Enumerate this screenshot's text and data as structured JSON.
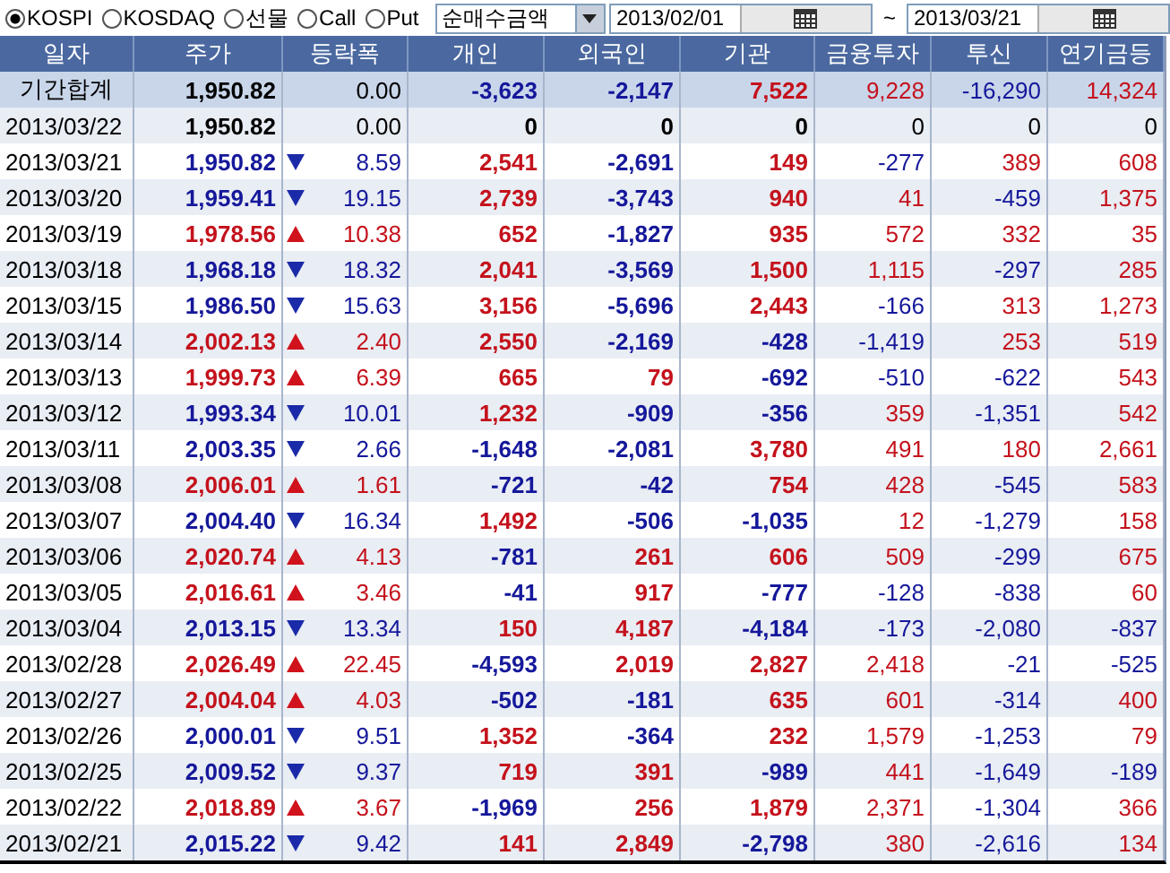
{
  "toolbar": {
    "markets": [
      {
        "label": "KOSPI",
        "selected": true
      },
      {
        "label": "KOSDAQ",
        "selected": false
      },
      {
        "label": "선물",
        "selected": false
      },
      {
        "label": "Call",
        "selected": false
      },
      {
        "label": "Put",
        "selected": false
      }
    ],
    "measure": {
      "value": "순매수금액"
    },
    "date_from": {
      "value": "2013/02/01"
    },
    "range_separator": "~",
    "date_to": {
      "value": "2013/03/21"
    }
  },
  "table": {
    "columns": [
      "일자",
      "주가",
      "등락폭",
      "개인",
      "외국인",
      "기관",
      "금융투자",
      "투신",
      "연기금등"
    ],
    "rows": [
      {
        "kind": "summary",
        "date": "기간합계",
        "price": "1,950.82",
        "color": "#000000",
        "change": "0.00",
        "flows": [
          {
            "value": "-3,623",
            "color": "#15189a"
          },
          {
            "value": "-2,147",
            "color": "#15189a"
          },
          {
            "value": "7,522",
            "color": "#c4121c"
          },
          {
            "value": "9,228",
            "color": "#c4121c"
          },
          {
            "value": "-16,290",
            "color": "#15189a"
          },
          {
            "value": "14,324",
            "color": "#c4121c"
          }
        ]
      },
      {
        "kind": "flat",
        "date": "2013/03/22",
        "price": "1,950.82",
        "color": "#000000",
        "change": "0.00",
        "flows": [
          {
            "value": "0",
            "color": "#000000"
          },
          {
            "value": "0",
            "color": "#000000"
          },
          {
            "value": "0",
            "color": "#000000"
          },
          {
            "value": "0",
            "color": "#000000"
          },
          {
            "value": "0",
            "color": "#000000"
          },
          {
            "value": "0",
            "color": "#000000"
          }
        ]
      },
      {
        "kind": "fall",
        "date": "2013/03/21",
        "price": "1,950.82",
        "color": "#15189a",
        "change": "8.59",
        "flows": [
          {
            "value": "2,541",
            "color": "#c4121c"
          },
          {
            "value": "-2,691",
            "color": "#15189a"
          },
          {
            "value": "149",
            "color": "#c4121c"
          },
          {
            "value": "-277",
            "color": "#15189a"
          },
          {
            "value": "389",
            "color": "#c4121c"
          },
          {
            "value": "608",
            "color": "#c4121c"
          }
        ]
      },
      {
        "kind": "fall",
        "date": "2013/03/20",
        "price": "1,959.41",
        "color": "#15189a",
        "change": "19.15",
        "flows": [
          {
            "value": "2,739",
            "color": "#c4121c"
          },
          {
            "value": "-3,743",
            "color": "#15189a"
          },
          {
            "value": "940",
            "color": "#c4121c"
          },
          {
            "value": "41",
            "color": "#c4121c"
          },
          {
            "value": "-459",
            "color": "#15189a"
          },
          {
            "value": "1,375",
            "color": "#c4121c"
          }
        ]
      },
      {
        "kind": "rise",
        "date": "2013/03/19",
        "price": "1,978.56",
        "color": "#c4121c",
        "change": "10.38",
        "flows": [
          {
            "value": "652",
            "color": "#c4121c"
          },
          {
            "value": "-1,827",
            "color": "#15189a"
          },
          {
            "value": "935",
            "color": "#c4121c"
          },
          {
            "value": "572",
            "color": "#c4121c"
          },
          {
            "value": "332",
            "color": "#c4121c"
          },
          {
            "value": "35",
            "color": "#c4121c"
          }
        ]
      },
      {
        "kind": "fall",
        "date": "2013/03/18",
        "price": "1,968.18",
        "color": "#15189a",
        "change": "18.32",
        "flows": [
          {
            "value": "2,041",
            "color": "#c4121c"
          },
          {
            "value": "-3,569",
            "color": "#15189a"
          },
          {
            "value": "1,500",
            "color": "#c4121c"
          },
          {
            "value": "1,115",
            "color": "#c4121c"
          },
          {
            "value": "-297",
            "color": "#15189a"
          },
          {
            "value": "285",
            "color": "#c4121c"
          }
        ]
      },
      {
        "kind": "fall",
        "date": "2013/03/15",
        "price": "1,986.50",
        "color": "#15189a",
        "change": "15.63",
        "flows": [
          {
            "value": "3,156",
            "color": "#c4121c"
          },
          {
            "value": "-5,696",
            "color": "#15189a"
          },
          {
            "value": "2,443",
            "color": "#c4121c"
          },
          {
            "value": "-166",
            "color": "#15189a"
          },
          {
            "value": "313",
            "color": "#c4121c"
          },
          {
            "value": "1,273",
            "color": "#c4121c"
          }
        ]
      },
      {
        "kind": "rise",
        "date": "2013/03/14",
        "price": "2,002.13",
        "color": "#c4121c",
        "change": "2.40",
        "flows": [
          {
            "value": "2,550",
            "color": "#c4121c"
          },
          {
            "value": "-2,169",
            "color": "#15189a"
          },
          {
            "value": "-428",
            "color": "#15189a"
          },
          {
            "value": "-1,419",
            "color": "#15189a"
          },
          {
            "value": "253",
            "color": "#c4121c"
          },
          {
            "value": "519",
            "color": "#c4121c"
          }
        ]
      },
      {
        "kind": "rise",
        "date": "2013/03/13",
        "price": "1,999.73",
        "color": "#c4121c",
        "change": "6.39",
        "flows": [
          {
            "value": "665",
            "color": "#c4121c"
          },
          {
            "value": "79",
            "color": "#c4121c"
          },
          {
            "value": "-692",
            "color": "#15189a"
          },
          {
            "value": "-510",
            "color": "#15189a"
          },
          {
            "value": "-622",
            "color": "#15189a"
          },
          {
            "value": "543",
            "color": "#c4121c"
          }
        ]
      },
      {
        "kind": "fall",
        "date": "2013/03/12",
        "price": "1,993.34",
        "color": "#15189a",
        "change": "10.01",
        "flows": [
          {
            "value": "1,232",
            "color": "#c4121c"
          },
          {
            "value": "-909",
            "color": "#15189a"
          },
          {
            "value": "-356",
            "color": "#15189a"
          },
          {
            "value": "359",
            "color": "#c4121c"
          },
          {
            "value": "-1,351",
            "color": "#15189a"
          },
          {
            "value": "542",
            "color": "#c4121c"
          }
        ]
      },
      {
        "kind": "fall",
        "date": "2013/03/11",
        "price": "2,003.35",
        "color": "#15189a",
        "change": "2.66",
        "flows": [
          {
            "value": "-1,648",
            "color": "#15189a"
          },
          {
            "value": "-2,081",
            "color": "#15189a"
          },
          {
            "value": "3,780",
            "color": "#c4121c"
          },
          {
            "value": "491",
            "color": "#c4121c"
          },
          {
            "value": "180",
            "color": "#c4121c"
          },
          {
            "value": "2,661",
            "color": "#c4121c"
          }
        ]
      },
      {
        "kind": "rise",
        "date": "2013/03/08",
        "price": "2,006.01",
        "color": "#c4121c",
        "change": "1.61",
        "flows": [
          {
            "value": "-721",
            "color": "#15189a"
          },
          {
            "value": "-42",
            "color": "#15189a"
          },
          {
            "value": "754",
            "color": "#c4121c"
          },
          {
            "value": "428",
            "color": "#c4121c"
          },
          {
            "value": "-545",
            "color": "#15189a"
          },
          {
            "value": "583",
            "color": "#c4121c"
          }
        ]
      },
      {
        "kind": "fall",
        "date": "2013/03/07",
        "price": "2,004.40",
        "color": "#15189a",
        "change": "16.34",
        "flows": [
          {
            "value": "1,492",
            "color": "#c4121c"
          },
          {
            "value": "-506",
            "color": "#15189a"
          },
          {
            "value": "-1,035",
            "color": "#15189a"
          },
          {
            "value": "12",
            "color": "#c4121c"
          },
          {
            "value": "-1,279",
            "color": "#15189a"
          },
          {
            "value": "158",
            "color": "#c4121c"
          }
        ]
      },
      {
        "kind": "rise",
        "date": "2013/03/06",
        "price": "2,020.74",
        "color": "#c4121c",
        "change": "4.13",
        "flows": [
          {
            "value": "-781",
            "color": "#15189a"
          },
          {
            "value": "261",
            "color": "#c4121c"
          },
          {
            "value": "606",
            "color": "#c4121c"
          },
          {
            "value": "509",
            "color": "#c4121c"
          },
          {
            "value": "-299",
            "color": "#15189a"
          },
          {
            "value": "675",
            "color": "#c4121c"
          }
        ]
      },
      {
        "kind": "rise",
        "date": "2013/03/05",
        "price": "2,016.61",
        "color": "#c4121c",
        "change": "3.46",
        "flows": [
          {
            "value": "-41",
            "color": "#15189a"
          },
          {
            "value": "917",
            "color": "#c4121c"
          },
          {
            "value": "-777",
            "color": "#15189a"
          },
          {
            "value": "-128",
            "color": "#15189a"
          },
          {
            "value": "-838",
            "color": "#15189a"
          },
          {
            "value": "60",
            "color": "#c4121c"
          }
        ]
      },
      {
        "kind": "fall",
        "date": "2013/03/04",
        "price": "2,013.15",
        "color": "#15189a",
        "change": "13.34",
        "flows": [
          {
            "value": "150",
            "color": "#c4121c"
          },
          {
            "value": "4,187",
            "color": "#c4121c"
          },
          {
            "value": "-4,184",
            "color": "#15189a"
          },
          {
            "value": "-173",
            "color": "#15189a"
          },
          {
            "value": "-2,080",
            "color": "#15189a"
          },
          {
            "value": "-837",
            "color": "#15189a"
          }
        ]
      },
      {
        "kind": "rise",
        "date": "2013/02/28",
        "price": "2,026.49",
        "color": "#c4121c",
        "change": "22.45",
        "flows": [
          {
            "value": "-4,593",
            "color": "#15189a"
          },
          {
            "value": "2,019",
            "color": "#c4121c"
          },
          {
            "value": "2,827",
            "color": "#c4121c"
          },
          {
            "value": "2,418",
            "color": "#c4121c"
          },
          {
            "value": "-21",
            "color": "#15189a"
          },
          {
            "value": "-525",
            "color": "#15189a"
          }
        ]
      },
      {
        "kind": "rise",
        "date": "2013/02/27",
        "price": "2,004.04",
        "color": "#c4121c",
        "change": "4.03",
        "flows": [
          {
            "value": "-502",
            "color": "#15189a"
          },
          {
            "value": "-181",
            "color": "#15189a"
          },
          {
            "value": "635",
            "color": "#c4121c"
          },
          {
            "value": "601",
            "color": "#c4121c"
          },
          {
            "value": "-314",
            "color": "#15189a"
          },
          {
            "value": "400",
            "color": "#c4121c"
          }
        ]
      },
      {
        "kind": "fall",
        "date": "2013/02/26",
        "price": "2,000.01",
        "color": "#15189a",
        "change": "9.51",
        "flows": [
          {
            "value": "1,352",
            "color": "#c4121c"
          },
          {
            "value": "-364",
            "color": "#15189a"
          },
          {
            "value": "232",
            "color": "#c4121c"
          },
          {
            "value": "1,579",
            "color": "#c4121c"
          },
          {
            "value": "-1,253",
            "color": "#15189a"
          },
          {
            "value": "79",
            "color": "#c4121c"
          }
        ]
      },
      {
        "kind": "fall",
        "date": "2013/02/25",
        "price": "2,009.52",
        "color": "#15189a",
        "change": "9.37",
        "flows": [
          {
            "value": "719",
            "color": "#c4121c"
          },
          {
            "value": "391",
            "color": "#c4121c"
          },
          {
            "value": "-989",
            "color": "#15189a"
          },
          {
            "value": "441",
            "color": "#c4121c"
          },
          {
            "value": "-1,649",
            "color": "#15189a"
          },
          {
            "value": "-189",
            "color": "#15189a"
          }
        ]
      },
      {
        "kind": "rise",
        "date": "2013/02/22",
        "price": "2,018.89",
        "color": "#c4121c",
        "change": "3.67",
        "flows": [
          {
            "value": "-1,969",
            "color": "#15189a"
          },
          {
            "value": "256",
            "color": "#c4121c"
          },
          {
            "value": "1,879",
            "color": "#c4121c"
          },
          {
            "value": "2,371",
            "color": "#c4121c"
          },
          {
            "value": "-1,304",
            "color": "#15189a"
          },
          {
            "value": "366",
            "color": "#c4121c"
          }
        ]
      },
      {
        "kind": "fall",
        "date": "2013/02/21",
        "price": "2,015.22",
        "color": "#15189a",
        "change": "9.42",
        "flows": [
          {
            "value": "141",
            "color": "#c4121c"
          },
          {
            "value": "2,849",
            "color": "#c4121c"
          },
          {
            "value": "-2,798",
            "color": "#15189a"
          },
          {
            "value": "380",
            "color": "#c4121c"
          },
          {
            "value": "-2,616",
            "color": "#15189a"
          },
          {
            "value": "134",
            "color": "#c4121c"
          }
        ]
      }
    ]
  }
}
